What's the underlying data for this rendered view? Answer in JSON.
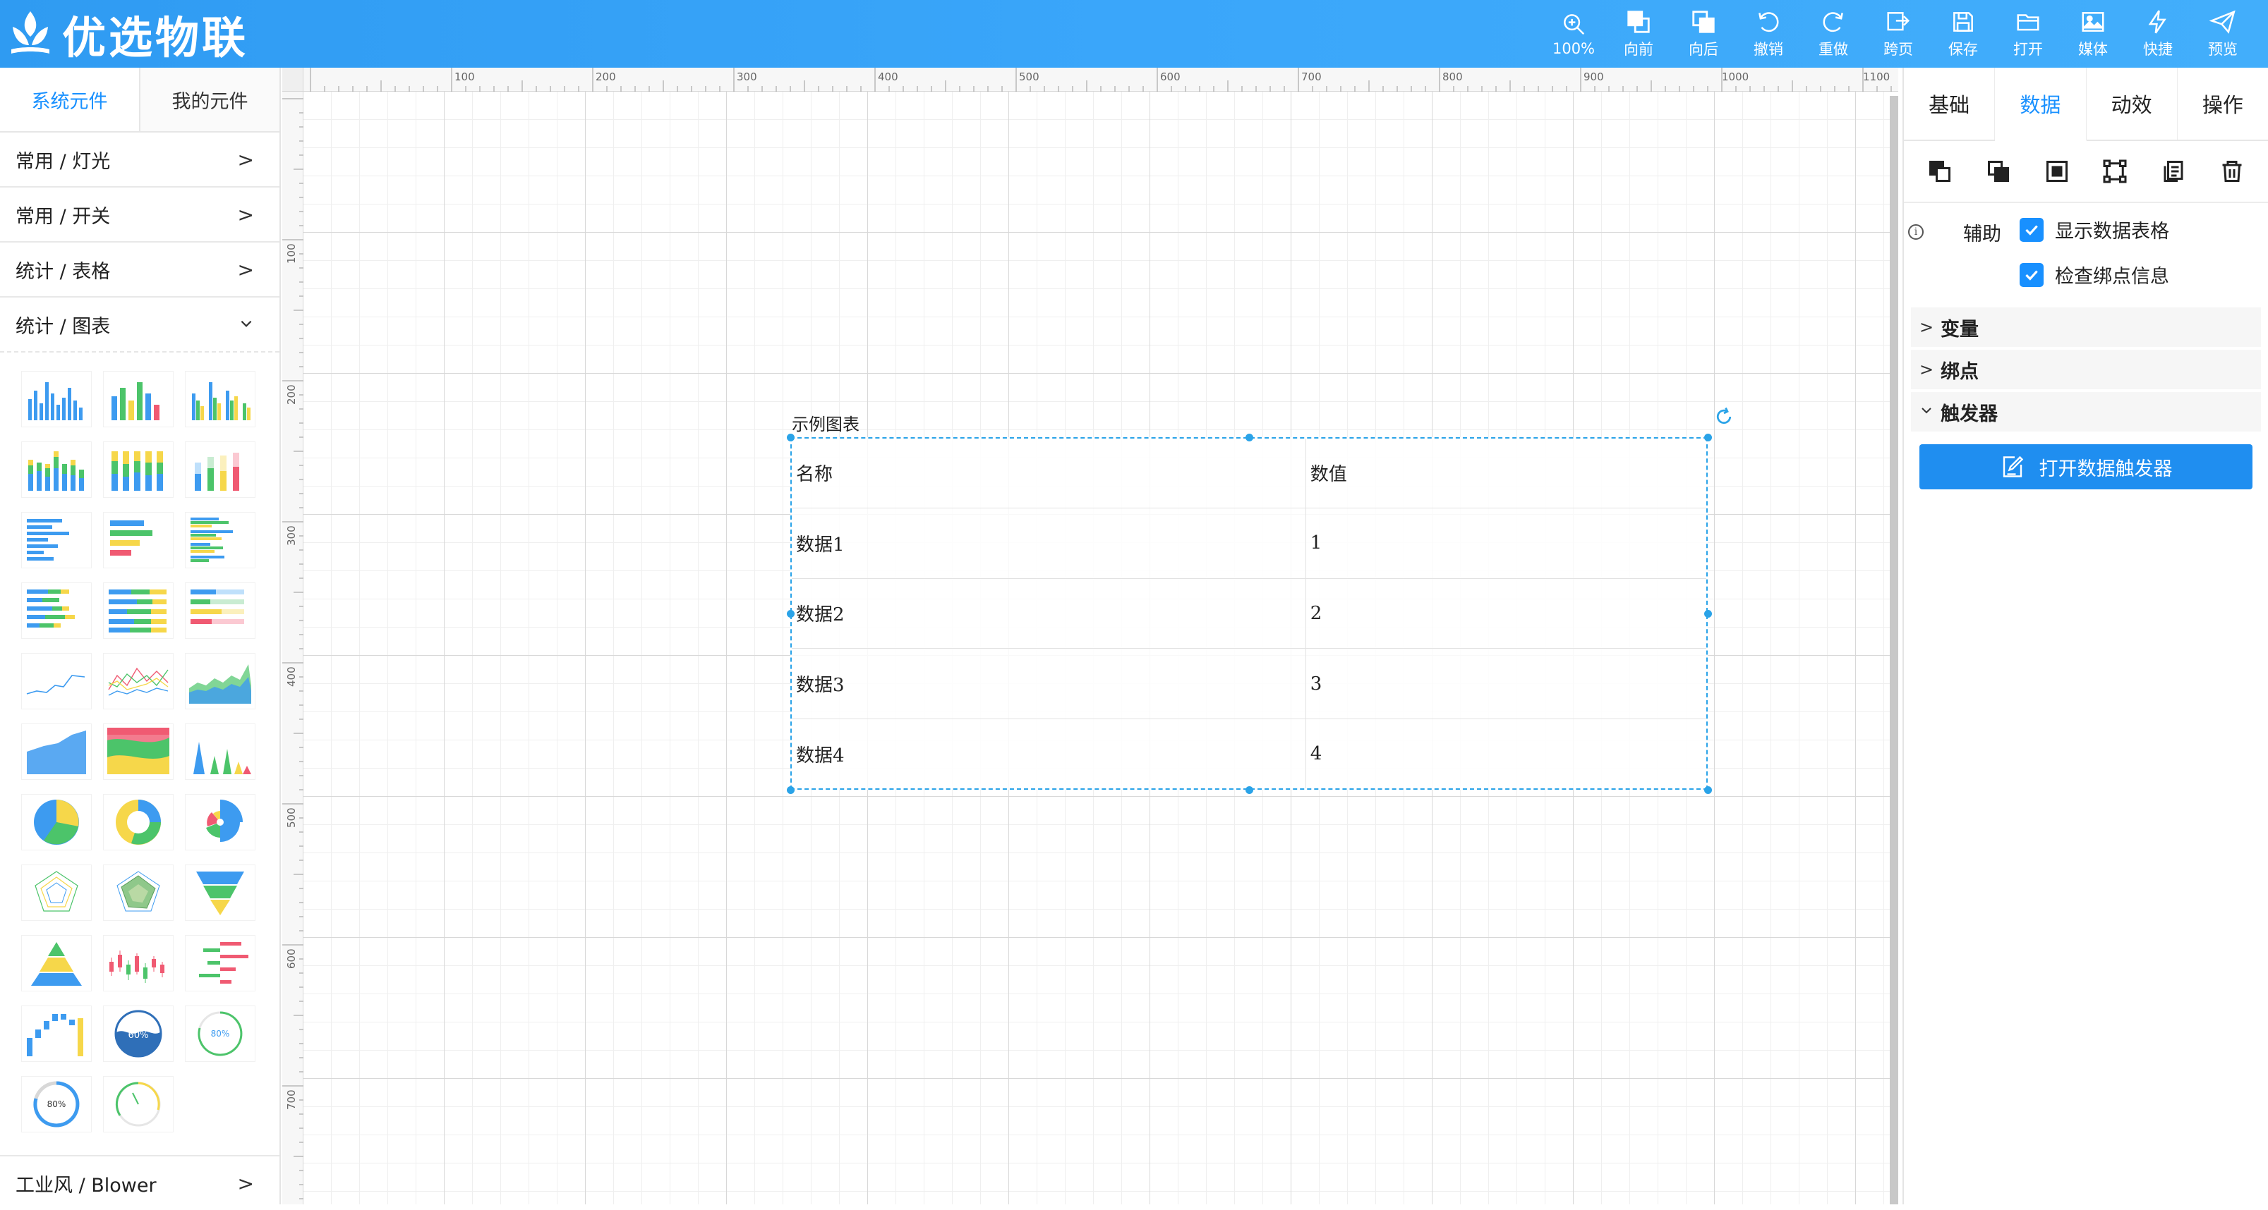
{
  "app": {
    "title": "优选物联"
  },
  "toolbar": [
    {
      "id": "zoom",
      "label": "100%",
      "icon": "zoom-in-icon"
    },
    {
      "id": "forward",
      "label": "向前",
      "icon": "bring-forward-icon"
    },
    {
      "id": "backward",
      "label": "向后",
      "icon": "send-backward-icon"
    },
    {
      "id": "undo",
      "label": "撤销",
      "icon": "undo-icon"
    },
    {
      "id": "redo",
      "label": "重做",
      "icon": "redo-icon"
    },
    {
      "id": "crosspage",
      "label": "跨页",
      "icon": "cross-page-icon"
    },
    {
      "id": "save",
      "label": "保存",
      "icon": "save-icon"
    },
    {
      "id": "open",
      "label": "打开",
      "icon": "folder-open-icon"
    },
    {
      "id": "media",
      "label": "媒体",
      "icon": "image-icon"
    },
    {
      "id": "shortcut",
      "label": "快捷",
      "icon": "lightning-icon"
    },
    {
      "id": "preview",
      "label": "预览",
      "icon": "send-icon"
    }
  ],
  "left": {
    "tabs": [
      "系统元件",
      "我的元件"
    ],
    "categories": [
      "常用 / 灯光",
      "常用 / 开关",
      "统计 / 表格",
      "统计 / 图表"
    ],
    "bottom_category": "工业风 / Blower",
    "thumb_labels": {
      "gauge_water": "60%",
      "ring_a": "80%",
      "ring_b": "80%"
    }
  },
  "canvas": {
    "ruler_h": [
      "100",
      "200",
      "300",
      "400",
      "500",
      "600",
      "700",
      "800",
      "900",
      "1000",
      "1100"
    ],
    "ruler_v": [
      "100",
      "200",
      "300",
      "400",
      "500",
      "600",
      "700"
    ],
    "element_title": "示例图表",
    "table": {
      "header": [
        "名称",
        "数值"
      ],
      "rows": [
        [
          "数据1",
          "1"
        ],
        [
          "数据2",
          "2"
        ],
        [
          "数据3",
          "3"
        ],
        [
          "数据4",
          "4"
        ]
      ]
    }
  },
  "right": {
    "tabs": [
      "基础",
      "数据",
      "动效",
      "操作"
    ],
    "active_tab": "数据",
    "aux_label": "辅助",
    "checkboxes": [
      "显示数据表格",
      "检查绑点信息"
    ],
    "sections": [
      {
        "label": "变量",
        "open": false
      },
      {
        "label": "绑点",
        "open": false
      },
      {
        "label": "触发器",
        "open": true
      }
    ],
    "trigger_button": "打开数据触发器"
  },
  "colors": {
    "brand": "#3aa6fa",
    "accent": "#1890ff",
    "selection": "#2aa3e8"
  }
}
